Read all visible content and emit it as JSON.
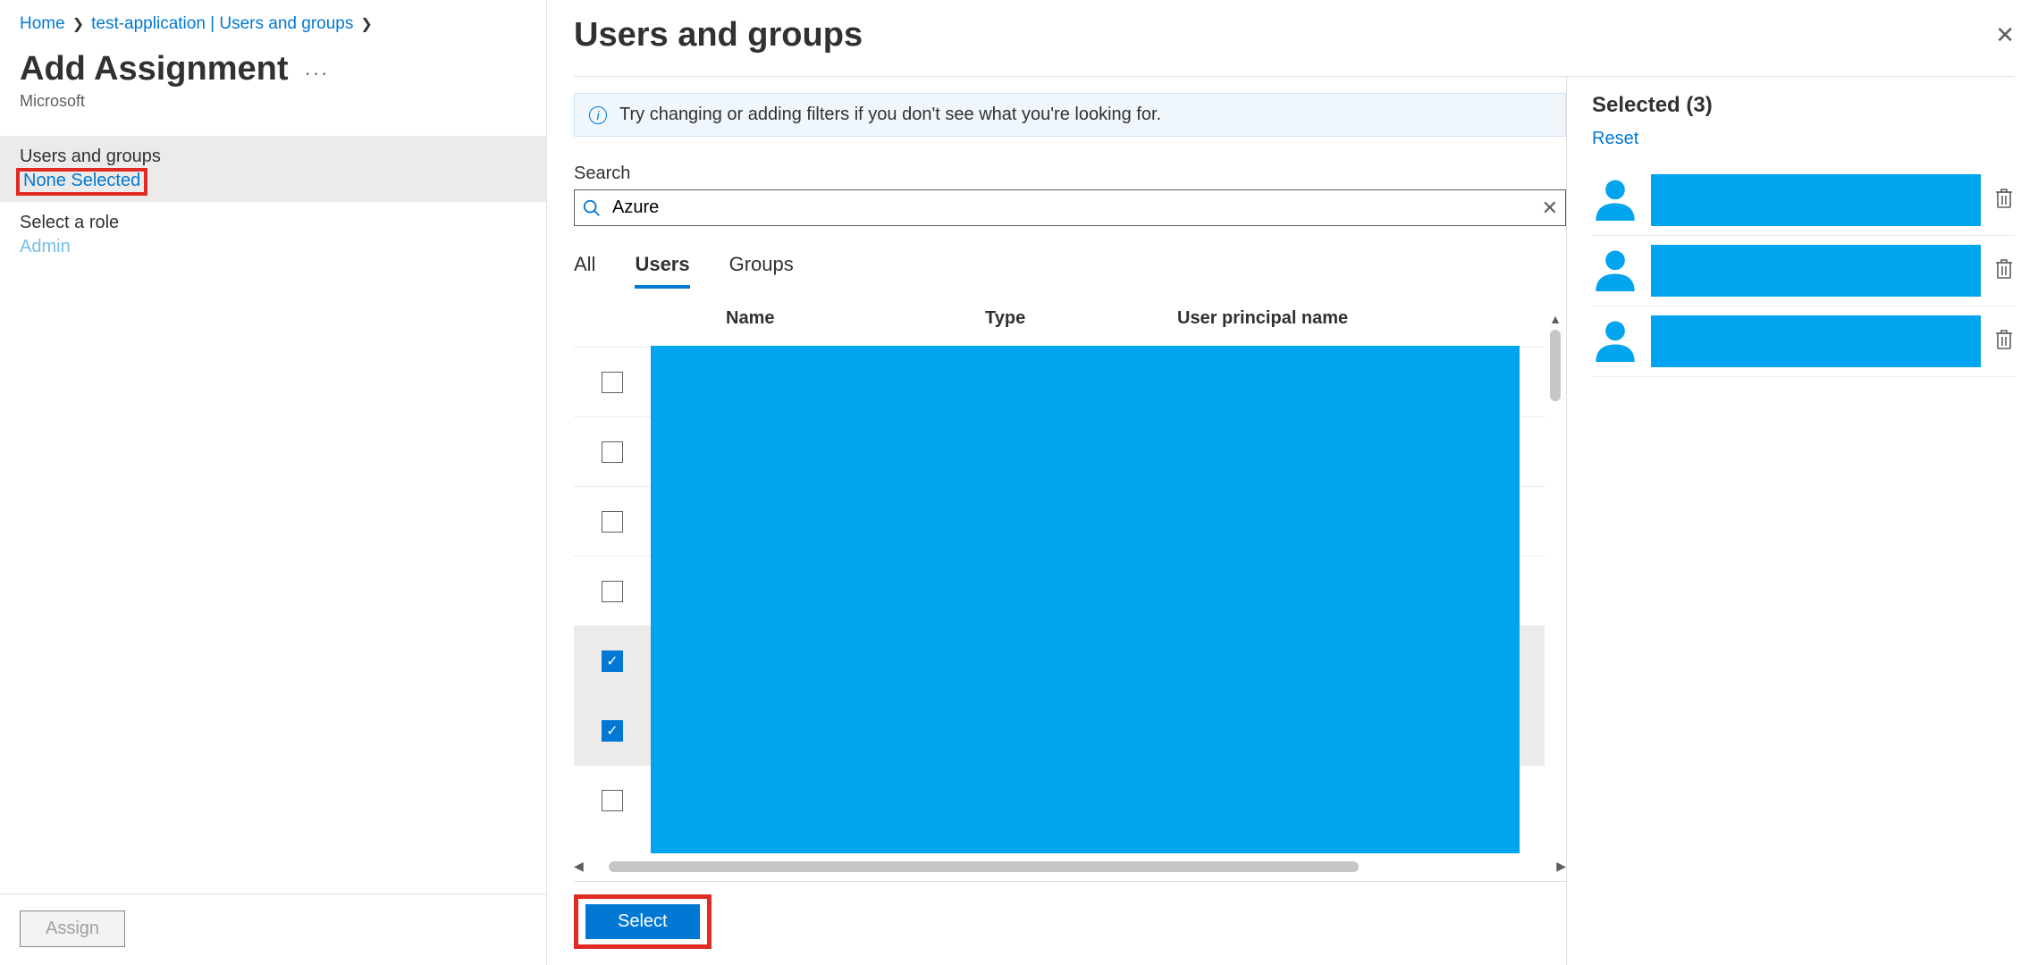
{
  "breadcrumb": {
    "home": "Home",
    "app": "test-application | Users and groups"
  },
  "page": {
    "title": "Add Assignment",
    "subtitle": "Microsoft"
  },
  "left": {
    "users_groups_label": "Users and groups",
    "users_groups_value": "None Selected",
    "role_label": "Select a role",
    "role_value": "Admin"
  },
  "assign_button": "Assign",
  "blade": {
    "title": "Users and groups",
    "info": "Try changing or adding filters if you don't see what you're looking for.",
    "search_label": "Search",
    "search_value": "Azure",
    "tabs": {
      "all": "All",
      "users": "Users",
      "groups": "Groups"
    },
    "columns": {
      "name": "Name",
      "type": "Type",
      "upn": "User principal name"
    },
    "rows": [
      {
        "checked": false,
        "selected": false
      },
      {
        "checked": false,
        "selected": false
      },
      {
        "checked": false,
        "selected": false
      },
      {
        "checked": false,
        "selected": false
      },
      {
        "checked": true,
        "selected": true
      },
      {
        "checked": true,
        "selected": true
      },
      {
        "checked": false,
        "selected": false
      }
    ],
    "select_button": "Select"
  },
  "selected": {
    "title": "Selected (3)",
    "reset": "Reset",
    "items": [
      {},
      {},
      {}
    ]
  }
}
